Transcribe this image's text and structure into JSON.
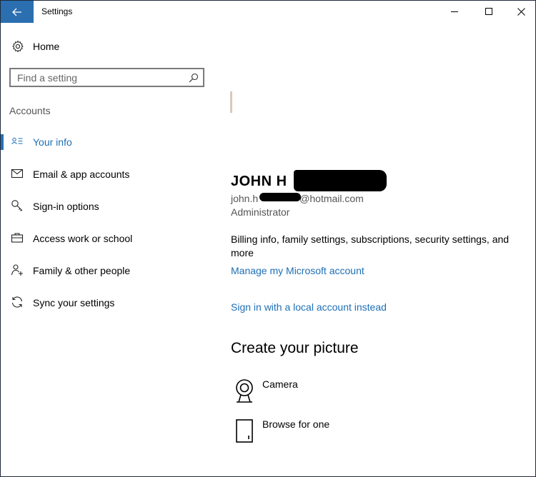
{
  "window": {
    "title": "Settings",
    "back_icon": "back-arrow-icon",
    "controls": [
      "minimize-icon",
      "maximize-icon",
      "close-icon"
    ],
    "accent_color": "#2b6fb1",
    "link_color": "#1e6fb5"
  },
  "sidebar": {
    "home_label": "Home",
    "home_icon": "gear-icon",
    "search_placeholder": "Find a setting",
    "search_icon": "search-icon",
    "section_heading": "Accounts",
    "items": [
      {
        "label": "Your info",
        "icon": "contact-card-icon",
        "active": true
      },
      {
        "label": "Email & app accounts",
        "icon": "mail-icon",
        "active": false
      },
      {
        "label": "Sign-in options",
        "icon": "key-icon",
        "active": false
      },
      {
        "label": "Access work or school",
        "icon": "briefcase-icon",
        "active": false
      },
      {
        "label": "Family & other people",
        "icon": "people-icon",
        "active": false
      },
      {
        "label": "Sync your settings",
        "icon": "sync-icon",
        "active": false
      }
    ]
  },
  "main": {
    "user_name": "JOHN H",
    "user_email_prefix": "john.h",
    "user_email_suffix": "@hotmail.com",
    "user_role": "Administrator",
    "billing_text": "Billing info, family settings, subscriptions, security settings, and more",
    "manage_link": "Manage my Microsoft account",
    "local_account_link": "Sign in with a local account instead",
    "create_picture_heading": "Create your picture",
    "picture_options": [
      {
        "label": "Camera",
        "icon": "camera-icon"
      },
      {
        "label": "Browse for one",
        "icon": "file-icon"
      }
    ]
  }
}
